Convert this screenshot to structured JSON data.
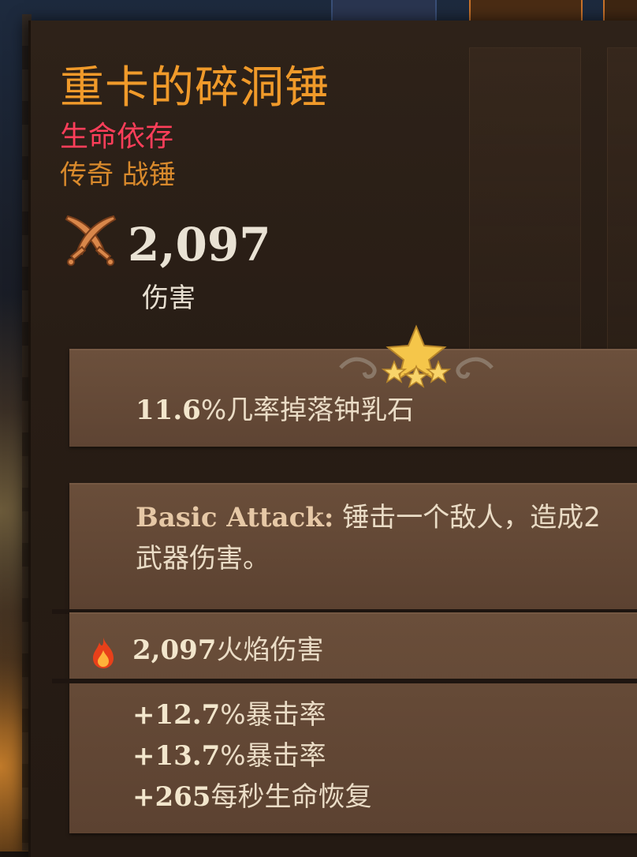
{
  "item": {
    "name": "重卡的碎洞锤",
    "set_name": "生命依存",
    "rarity_type": "传奇 战锤",
    "damage_value": "2,097",
    "damage_label": "伤害"
  },
  "affix": {
    "value": "11.6",
    "text": "%几率掉落钟乳石"
  },
  "skill": {
    "keyword": "Basic Attack:",
    "text_line1": " 锤击一个敌人，造成2",
    "text_line2": "武器伤害。"
  },
  "fire_damage": {
    "value": "2,097",
    "label": "火焰伤害",
    "icon": "fire-icon"
  },
  "stats": [
    {
      "value": "+12.7",
      "label": "%暴击率"
    },
    {
      "value": "+13.7",
      "label": "%暴击率"
    },
    {
      "value": "+265",
      "label": "每秒生命恢复"
    }
  ],
  "colors": {
    "title": "#f09a2a",
    "set_name": "#ff3e5a",
    "rarity": "#d98a2c",
    "panel": "#2a1f16",
    "band": "#6a4e3a"
  },
  "icons": {
    "damage": "crossed-swords-icon",
    "ornament": "star-ornament-icon"
  }
}
